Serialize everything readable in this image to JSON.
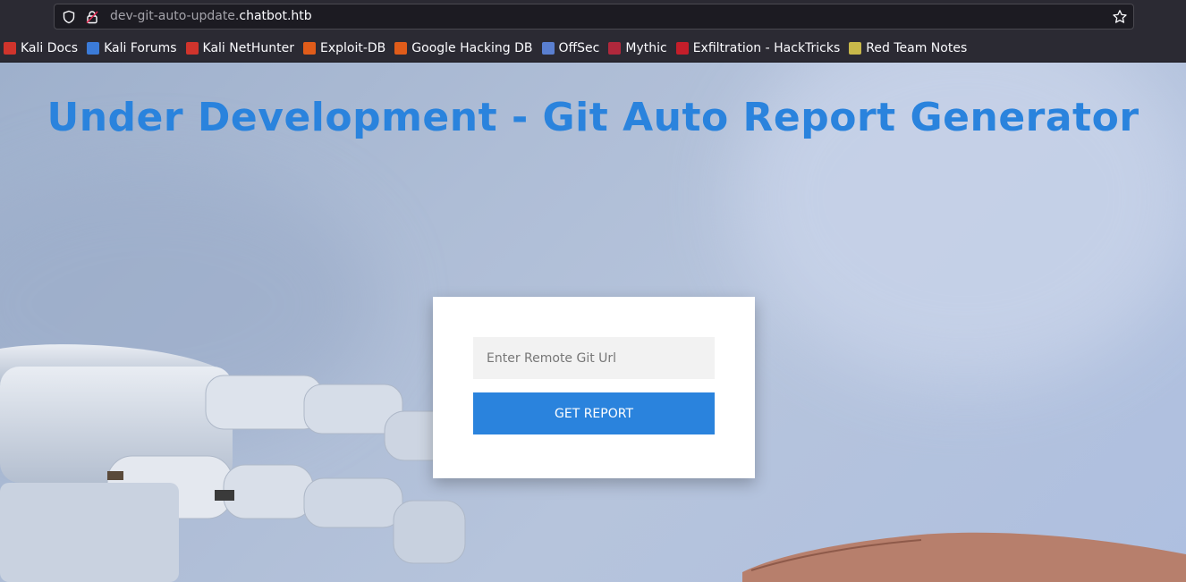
{
  "browser": {
    "url_prefix": "dev-git-auto-update.",
    "url_domain": "chatbot.htb",
    "bookmarks": [
      {
        "label": "Kali Docs",
        "icon": "kali-docs-icon",
        "color": "#d0342c"
      },
      {
        "label": "Kali Forums",
        "icon": "kali-forums-icon",
        "color": "#3b7bd8"
      },
      {
        "label": "Kali NetHunter",
        "icon": "kali-nethunter-icon",
        "color": "#d0342c"
      },
      {
        "label": "Exploit-DB",
        "icon": "exploit-db-icon",
        "color": "#e05c1a"
      },
      {
        "label": "Google Hacking DB",
        "icon": "ghdb-icon",
        "color": "#e05c1a"
      },
      {
        "label": "OffSec",
        "icon": "offsec-icon",
        "color": "#5a7fd0"
      },
      {
        "label": "Mythic",
        "icon": "mythic-icon",
        "color": "#b0283c"
      },
      {
        "label": "Exfiltration - HackTricks",
        "icon": "hacktricks-icon",
        "color": "#c41e2a"
      },
      {
        "label": "Red Team Notes",
        "icon": "red-team-notes-icon",
        "color": "#c8b84a"
      }
    ]
  },
  "page": {
    "title": "Under Development - Git Auto Report Generator",
    "input_placeholder": "Enter Remote Git Url",
    "button_label": "GET REPORT"
  },
  "colors": {
    "accent": "#2a83dd",
    "chrome_bg": "#2b2a33"
  }
}
